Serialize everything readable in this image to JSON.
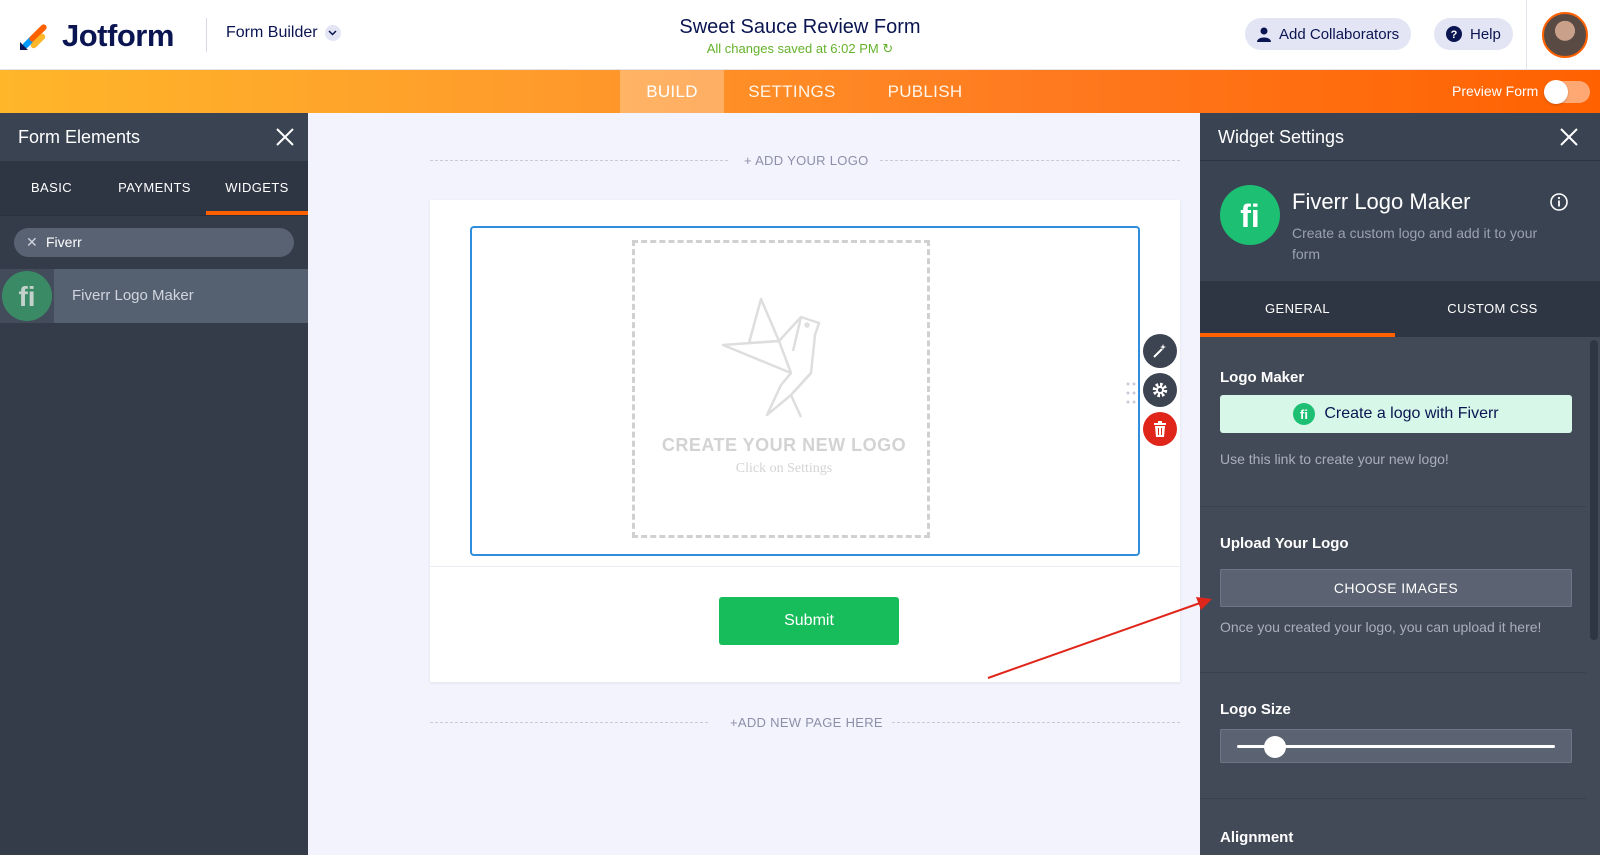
{
  "header": {
    "brand": "Jotform",
    "builder_label": "Form Builder",
    "form_title": "Sweet Sauce Review Form",
    "saved_status": "All changes saved at 6:02 PM",
    "collab_label": "Add Collaborators",
    "help_label": "Help"
  },
  "nav": {
    "tabs": [
      "BUILD",
      "SETTINGS",
      "PUBLISH"
    ],
    "preview_label": "Preview Form",
    "preview_on": false
  },
  "left_panel": {
    "title": "Form Elements",
    "tabs": [
      "BASIC",
      "PAYMENTS",
      "WIDGETS"
    ],
    "active_tab": "WIDGETS",
    "search_value": "Fiverr",
    "results": [
      "Fiverr Logo Maker"
    ]
  },
  "canvas": {
    "add_logo": "+ ADD YOUR LOGO",
    "placeholder_title": "CREATE YOUR NEW LOGO",
    "placeholder_sub": "Click on Settings",
    "submit_label": "Submit",
    "add_page": "+ADD NEW PAGE HERE"
  },
  "right_panel": {
    "title": "Widget Settings",
    "widget_name": "Fiverr Logo Maker",
    "widget_desc": "Create a custom logo and add it to your form",
    "tabs": [
      "GENERAL",
      "CUSTOM CSS"
    ],
    "active_tab": "GENERAL",
    "logo_maker": {
      "label": "Logo Maker",
      "button": "Create a logo with Fiverr",
      "help": "Use this link to create your new logo!"
    },
    "upload": {
      "label": "Upload Your Logo",
      "button": "CHOOSE IMAGES",
      "help": "Once you created your logo, you can upload it here!"
    },
    "logo_size": {
      "label": "Logo Size",
      "value_fraction": 0.12
    },
    "alignment": {
      "label": "Alignment"
    }
  },
  "colors": {
    "brand_navy": "#0a1551",
    "orange": "#ff6100",
    "fiverr_green": "#1dbf73",
    "submit_green": "#18bd5b",
    "annotation_red": "#e0261b"
  }
}
